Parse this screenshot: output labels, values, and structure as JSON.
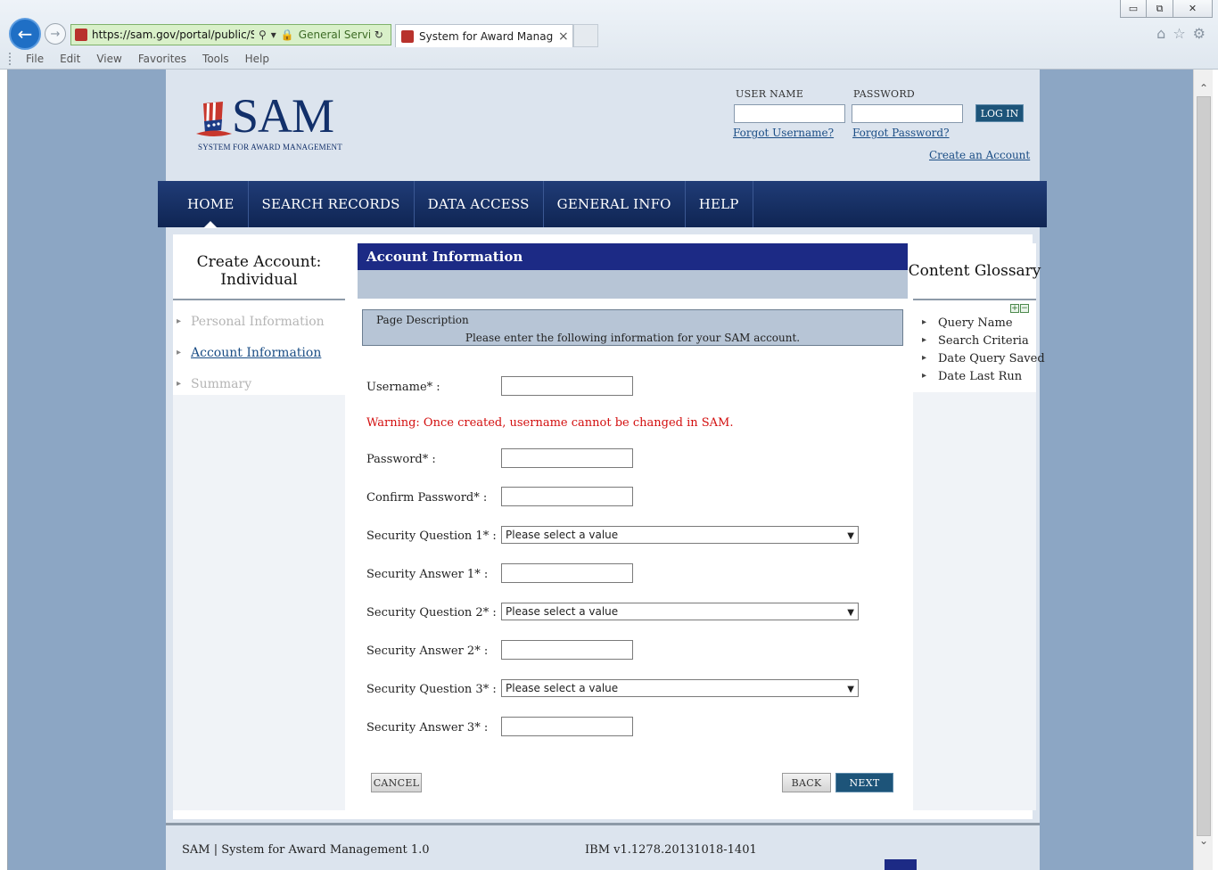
{
  "browser": {
    "url": "https://sam.gov/portal/public/SAI",
    "cert_label": "General Servi...",
    "tab_title": "System for Award Manage...",
    "menu": [
      "File",
      "Edit",
      "View",
      "Favorites",
      "Tools",
      "Help"
    ],
    "window_controls": {
      "minimize": "▭",
      "restore": "⧉",
      "close": "✕"
    },
    "icons": {
      "home": "⌂",
      "favorites": "☆",
      "settings": "⚙"
    }
  },
  "header": {
    "logo_text": "SAM",
    "logo_subtitle": "SYSTEM FOR AWARD MANAGEMENT",
    "username_label": "USER NAME",
    "password_label": "PASSWORD",
    "login_button": "LOG IN",
    "forgot_username": "Forgot Username?",
    "forgot_password": "Forgot Password?",
    "create_account": "Create an Account"
  },
  "nav": {
    "items": [
      "HOME",
      "SEARCH RECORDS",
      "DATA ACCESS",
      "GENERAL INFO",
      "HELP"
    ],
    "active": "HOME"
  },
  "left_nav": {
    "title_line1": "Create Account:",
    "title_line2": "Individual",
    "steps": [
      "Personal Information",
      "Account Information",
      "Summary"
    ],
    "current_step": "Account Information"
  },
  "main": {
    "section_title": "Account Information",
    "page_description_label": "Page Description",
    "page_description_text": "Please enter the following information for your SAM account.",
    "fields": {
      "username": "Username* :",
      "warning": "Warning: Once created, username cannot be changed in SAM.",
      "password": "Password* :",
      "confirm_password": "Confirm Password* :",
      "security_question_1": "Security Question 1* :",
      "security_answer_1": "Security Answer 1* :",
      "security_question_2": "Security Question 2* :",
      "security_answer_2": "Security Answer 2* :",
      "security_question_3": "Security Question 3* :",
      "security_answer_3": "Security Answer 3* :"
    },
    "select_placeholder": "Please select a value",
    "buttons": {
      "cancel": "CANCEL",
      "back": "BACK",
      "next": "NEXT"
    }
  },
  "glossary": {
    "title": "Content Glossary",
    "expand": "+",
    "collapse": "−",
    "items": [
      "Query Name",
      "Search Criteria",
      "Date Query Saved",
      "Date Last Run"
    ]
  },
  "footer": {
    "left": "SAM | System for Award Management 1.0",
    "version": "IBM v1.1278.20131018-1401"
  },
  "colors": {
    "nav_bg": "#0f2553",
    "section_header": "#1c2a85",
    "warning": "#d30f0f",
    "link": "#1a4d85",
    "viewport_bg": "#8ca6c4"
  }
}
